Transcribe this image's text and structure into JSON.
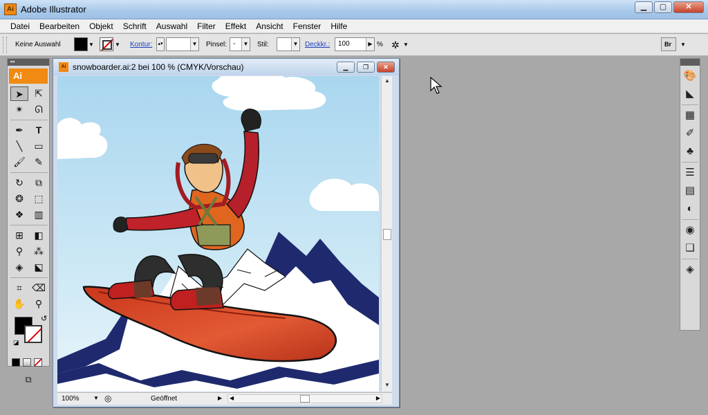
{
  "window": {
    "title": "Adobe Illustrator",
    "icon_text": "Ai"
  },
  "menu": [
    "Datei",
    "Bearbeiten",
    "Objekt",
    "Schrift",
    "Auswahl",
    "Filter",
    "Effekt",
    "Ansicht",
    "Fenster",
    "Hilfe"
  ],
  "control": {
    "selection": "Keine Auswahl",
    "kontur": "Kontur:",
    "pinsel": "Pinsel:",
    "pinsel_value": "-",
    "stil": "Stil:",
    "deckkr": "Deckkr.:",
    "opacity": "100",
    "percent": "%",
    "bridge": "Br"
  },
  "tools": {
    "logo": "Ai"
  },
  "document": {
    "title": "snowboarder.ai:2 bei 100 % (CMYK/Vorschau)",
    "zoom": "100%",
    "status": "Geöffnet"
  },
  "colors": {
    "accent": "#f08a12",
    "sky": "#c3e2f3",
    "mountain": "#1f2a6e",
    "board": "#d84a2a"
  }
}
